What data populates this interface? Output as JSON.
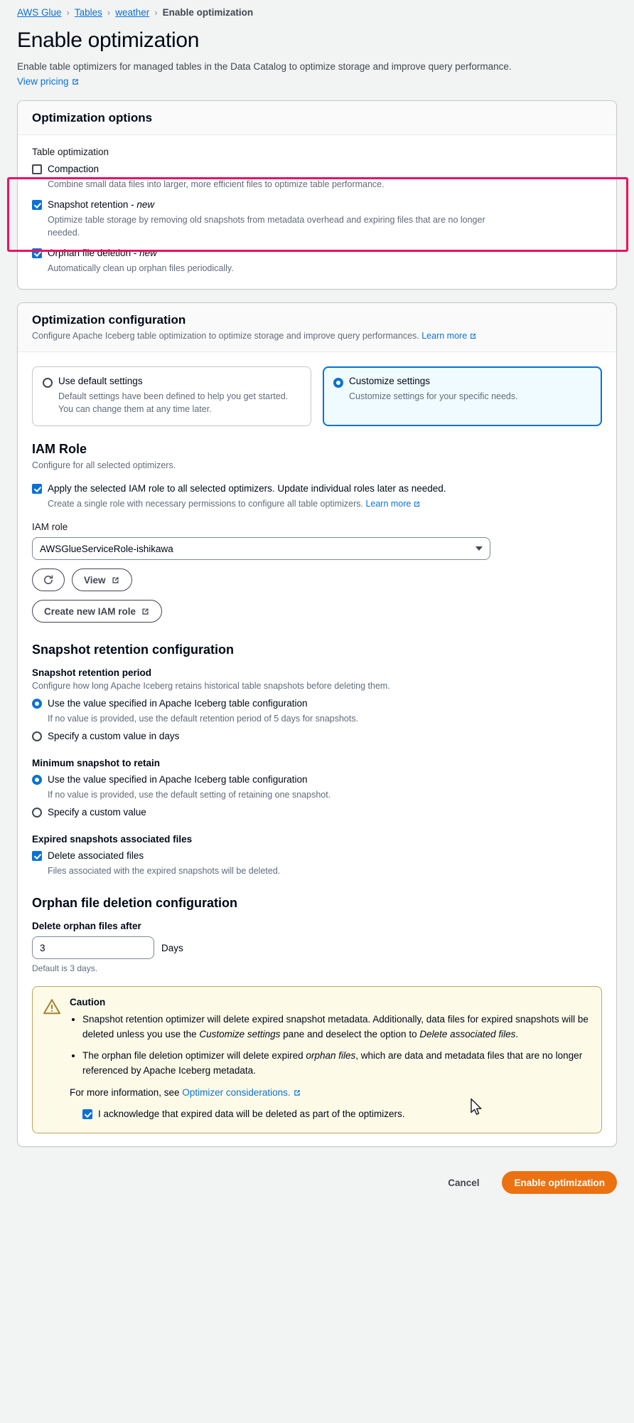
{
  "breadcrumb": {
    "items": [
      {
        "label": "AWS Glue",
        "link": true
      },
      {
        "label": "Tables",
        "link": true
      },
      {
        "label": "weather",
        "link": true
      },
      {
        "label": "Enable optimization",
        "link": false
      }
    ],
    "separator": "›"
  },
  "header": {
    "title": "Enable optimization",
    "description": "Enable table optimizers for managed tables in the Data Catalog to optimize storage and improve query performance.",
    "pricing_link": "View pricing"
  },
  "optimization_options": {
    "heading": "Optimization options",
    "group_label": "Table optimization",
    "items": [
      {
        "label": "Compaction",
        "badge": "",
        "checked": false,
        "description": "Combine small data files into larger, more efficient files to optimize table performance."
      },
      {
        "label": "Snapshot retention - ",
        "badge": "new",
        "checked": true,
        "description": "Optimize table storage by removing old snapshots from metadata overhead and expiring files that are no longer needed."
      },
      {
        "label": "Orphan file deletion - ",
        "badge": "new",
        "checked": true,
        "description": "Automatically clean up orphan files periodically."
      }
    ]
  },
  "optimization_configuration": {
    "heading": "Optimization configuration",
    "description": "Configure Apache Iceberg table optimization to optimize storage and improve query performances.",
    "learn_more": "Learn more",
    "tiles": [
      {
        "title": "Use default settings",
        "description": "Default settings have been defined to help you get started. You can change them at any time later.",
        "selected": false
      },
      {
        "title": "Customize settings",
        "description": "Customize settings for your specific needs.",
        "selected": true
      }
    ],
    "iam": {
      "heading": "IAM Role",
      "description": "Configure for all selected optimizers.",
      "apply_checkbox": {
        "label": "Apply the selected IAM role to all selected optimizers. Update individual roles later as needed.",
        "checked": true,
        "description": "Create a single role with necessary permissions to configure all table optimizers.",
        "learn_more": "Learn more"
      },
      "role_label": "IAM role",
      "role_value": "AWSGlueServiceRole-ishikawa",
      "refresh_icon": "refresh-icon",
      "view_button": "View",
      "create_button": "Create new IAM role"
    },
    "snapshot_retention": {
      "heading": "Snapshot retention configuration",
      "period": {
        "label": "Snapshot retention period",
        "description": "Configure how long Apache Iceberg retains historical table snapshots before deleting them.",
        "options": [
          {
            "label": "Use the value specified in Apache Iceberg table configuration",
            "description": "If no value is provided, use the default retention period of 5 days for snapshots.",
            "selected": true
          },
          {
            "label": "Specify a custom value in days",
            "description": "",
            "selected": false
          }
        ]
      },
      "minimum": {
        "label": "Minimum snapshot to retain",
        "options": [
          {
            "label": "Use the value specified in Apache Iceberg table configuration",
            "description": "If no value is provided, use the default setting of retaining one snapshot.",
            "selected": true
          },
          {
            "label": "Specify a custom value",
            "description": "",
            "selected": false
          }
        ]
      },
      "expired": {
        "label": "Expired snapshots associated files",
        "checkbox": {
          "label": "Delete associated files",
          "checked": true,
          "description": "Files associated with the expired snapshots will be deleted."
        }
      }
    },
    "orphan_deletion": {
      "heading": "Orphan file deletion configuration",
      "field_label": "Delete orphan files after",
      "value": "3",
      "unit": "Days",
      "hint": "Default is 3 days."
    },
    "caution": {
      "title": "Caution",
      "bullets": [
        {
          "parts": [
            {
              "t": "Snapshot retention optimizer will delete expired snapshot metadata. Additionally, data files for expired snapshots will be deleted unless you use the ",
              "i": false
            },
            {
              "t": "Customize settings",
              "i": true
            },
            {
              "t": " pane and deselect the option to ",
              "i": false
            },
            {
              "t": "Delete associated files",
              "i": true
            },
            {
              "t": ".",
              "i": false
            }
          ]
        },
        {
          "parts": [
            {
              "t": "The orphan file deletion optimizer will delete expired ",
              "i": false
            },
            {
              "t": "orphan files",
              "i": true
            },
            {
              "t": ", which are data and metadata files that are no longer referenced by Apache Iceberg metadata.",
              "i": false
            }
          ]
        }
      ],
      "footer_text": "For more information, see ",
      "footer_link": "Optimizer considerations.",
      "ack_checkbox": {
        "label": "I acknowledge that expired data will be deleted as part of the optimizers.",
        "checked": true
      }
    }
  },
  "footer": {
    "cancel": "Cancel",
    "submit": "Enable optimization"
  },
  "colors": {
    "accent_blue": "#0972d3",
    "primary_orange": "#ec7211",
    "highlight_pink": "#eb1261",
    "caution_border": "#bda55d",
    "caution_bg": "#fdfbe8"
  }
}
